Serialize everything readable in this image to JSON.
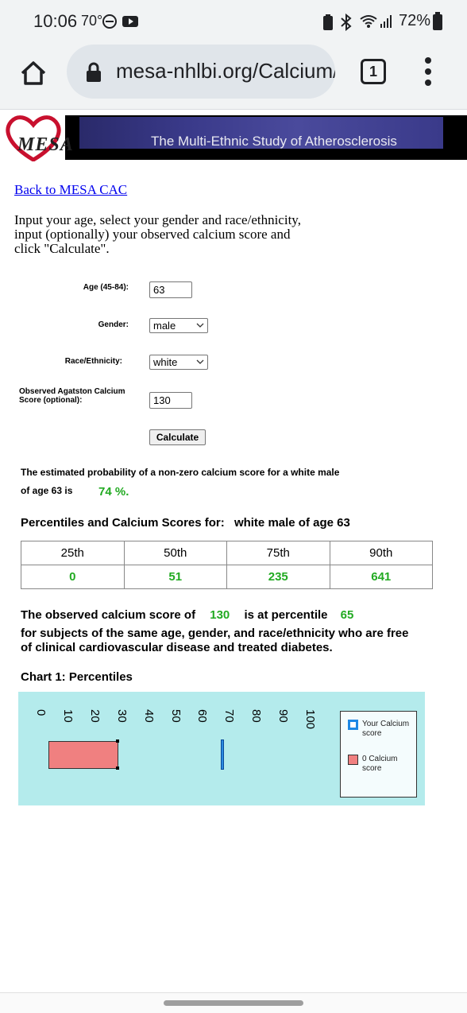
{
  "status_bar": {
    "time": "10:06",
    "temperature": "70°",
    "battery": "72%"
  },
  "browser": {
    "url": "mesa-nhlbi.org/Calcium/input.aspx",
    "tab_count": "1"
  },
  "banner": {
    "logo_text": "MESA",
    "title": "The Multi-Ethnic Study of Atherosclerosis"
  },
  "page": {
    "back_link": "Back to MESA CAC",
    "instructions": "Input your age, select your gender and race/ethnicity, input (optionally) your observed calcium score and click \"Calculate\".",
    "form": {
      "age_label": "Age (45-84):",
      "age_value": "63",
      "gender_label": "Gender:",
      "gender_value": "male",
      "race_label": "Race/Ethnicity:",
      "race_value": "white",
      "score_label": "Observed Agatston Calcium Score (optional):",
      "score_value": "130",
      "calculate_label": "Calculate"
    },
    "probability": {
      "line1": "The estimated probability of a non-zero calcium score for a white male",
      "line2": "of age 63 is",
      "value": "74 %."
    },
    "percentiles": {
      "heading": "Percentiles and Calcium Scores for:",
      "subject": "white male of age 63",
      "headers": [
        "25th",
        "50th",
        "75th",
        "90th"
      ],
      "values": [
        "0",
        "51",
        "235",
        "641"
      ]
    },
    "observed": {
      "prefix": "The observed calcium score of",
      "score": "130",
      "middle": "is at percentile",
      "percentile": "65",
      "line2": "for subjects of the same age, gender, and race/ethnicity who are free",
      "line3": "of clinical cardiovascular disease and treated diabetes."
    },
    "chart_title": "Chart 1: Percentiles"
  },
  "chart_data": {
    "type": "bar",
    "title": "Chart 1: Percentiles",
    "x_ticks": [
      "0",
      "10",
      "20",
      "30",
      "40",
      "50",
      "60",
      "70",
      "80",
      "90",
      "100"
    ],
    "xlim": [
      0,
      100
    ],
    "zero_calcium_range": [
      0,
      26
    ],
    "your_score_percentile": 65,
    "series": [
      {
        "name": "Your Calcium score",
        "color": "#1e88e5"
      },
      {
        "name": "0 Calcium score",
        "color": "#f08080"
      }
    ],
    "legend_placement": "right"
  },
  "colors": {
    "chart_background": "#b4ebec",
    "highlight_green": "#22aa22"
  }
}
